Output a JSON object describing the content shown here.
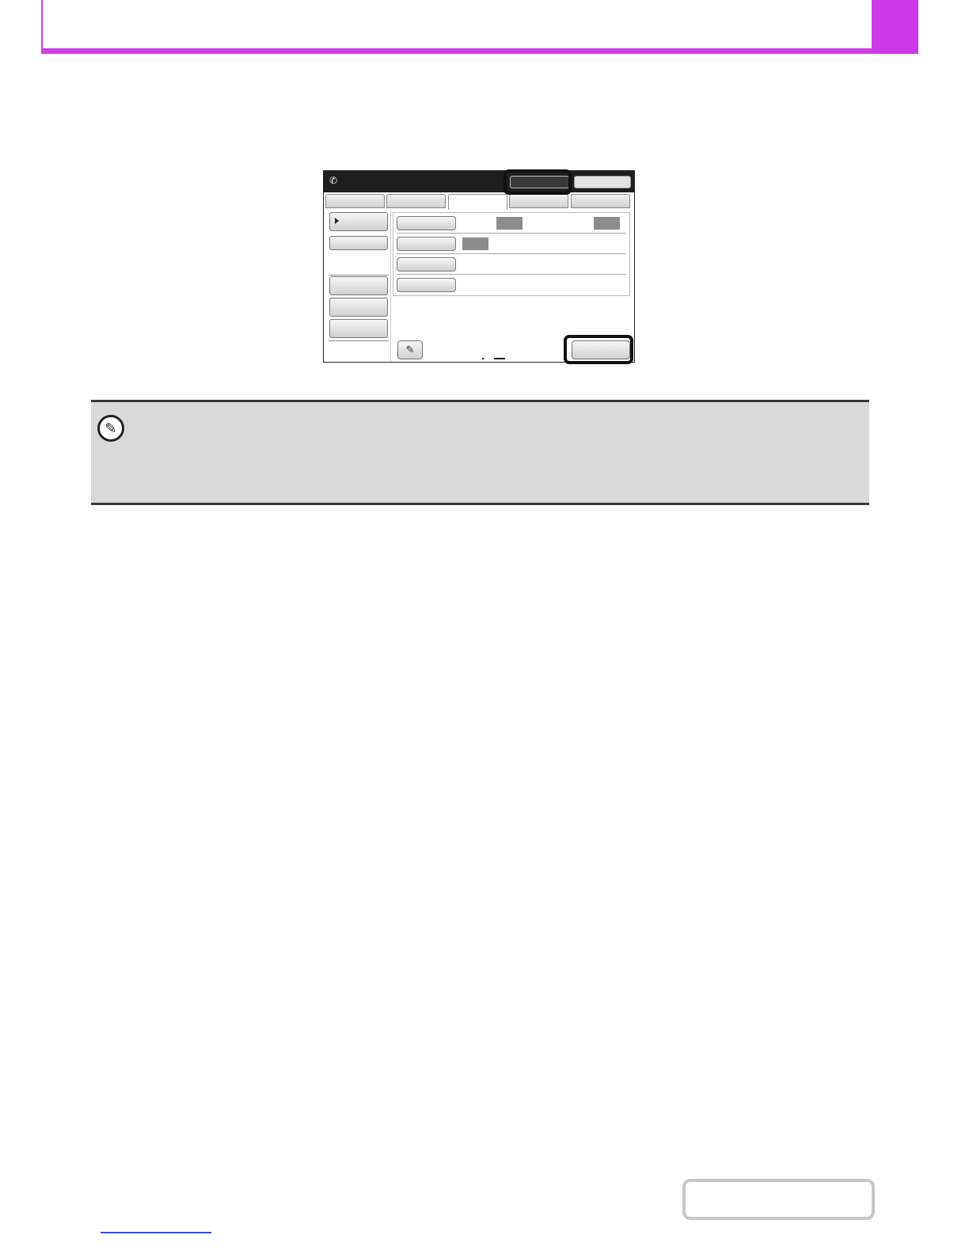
{
  "header": {
    "title": "",
    "tab_label": ""
  },
  "panel": {
    "title": "",
    "title_buttons": [
      "",
      ""
    ],
    "tabs": [
      "",
      "",
      "",
      "",
      ""
    ],
    "left_buttons": [
      "",
      "",
      "",
      "",
      ""
    ],
    "rows": [
      {
        "button": "",
        "values": [
          "",
          ""
        ]
      },
      {
        "button": "",
        "values": [
          ""
        ]
      },
      {
        "button": ""
      },
      {
        "button": ""
      }
    ],
    "ok_label": ""
  },
  "note": {
    "text": ""
  },
  "footer": {
    "contents_label": ""
  },
  "colors": {
    "accent": "#d23be6",
    "note_bg": "#d9d9d9"
  },
  "icons": {
    "title": "phone-handset-icon",
    "note": "pencil-icon",
    "bottom": "settings-sheet-icon"
  }
}
